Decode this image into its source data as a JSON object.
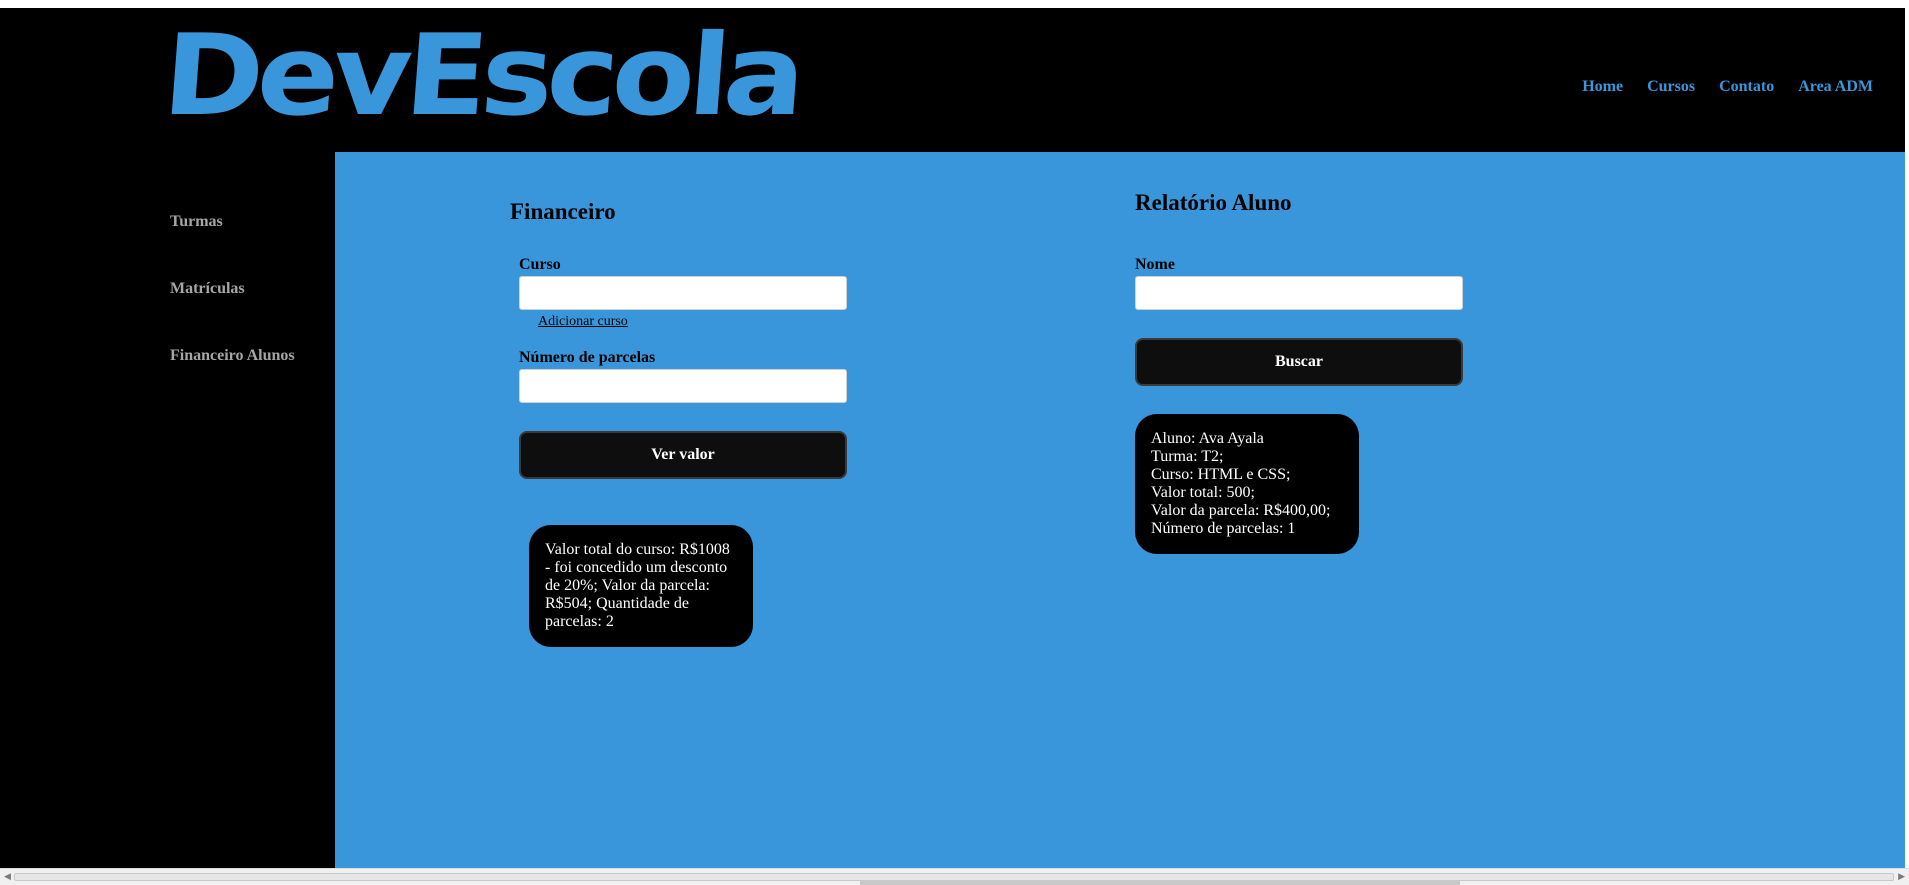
{
  "header": {
    "logo_text": "DevEscola",
    "nav": [
      "Home",
      "Cursos",
      "Contato",
      "Area ADM"
    ]
  },
  "sidebar": {
    "items": [
      "Turmas",
      "Matrículas",
      "Financeiro Alunos"
    ]
  },
  "financeiro": {
    "title": "Financeiro",
    "curso_label": "Curso",
    "curso_value": "",
    "add_course_link": "Adicionar curso",
    "parcelas_label": "Número de parcelas",
    "parcelas_value": "",
    "button": "Ver valor",
    "result_lines": [
      "Valor total do curso: R$1008",
      "- foi concedido um desconto",
      "de 20%; Valor da parcela:",
      "R$504; Quantidade de",
      "parcelas: 2"
    ]
  },
  "relatorio": {
    "title": "Relatório Aluno",
    "nome_label": "Nome",
    "nome_value": "",
    "button": "Buscar",
    "result_lines": [
      "Aluno: Ava Ayala",
      "Turma: T2;",
      "Curso: HTML e CSS;",
      "Valor total: 500;",
      "Valor da parcela: R$400,00;",
      "Número de parcelas: 1"
    ]
  },
  "colors": {
    "accent": "#3a96da",
    "background_dark": "#000000",
    "button": "#0e0e0f",
    "sidebar_text": "#a6a6a6"
  }
}
